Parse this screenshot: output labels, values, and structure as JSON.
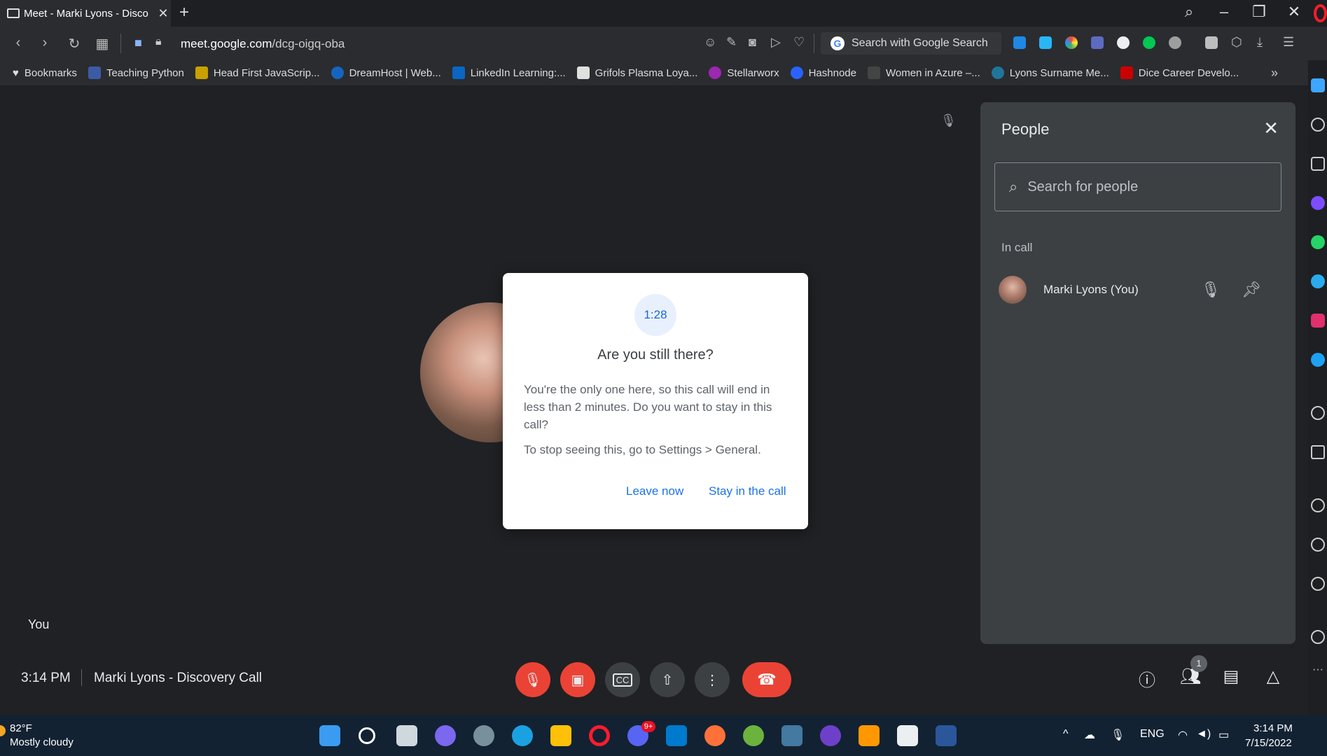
{
  "browser": {
    "tab_title": "Meet - Marki Lyons - Disco",
    "tab_close": "✕",
    "new_tab": "+",
    "url_domain": "meet.google.com",
    "url_path": "/dcg-oigq-oba",
    "search_label": "Search with Google Search",
    "bookmarks": [
      {
        "label": "Bookmarks",
        "color": "#dddddd"
      },
      {
        "label": "Teaching Python",
        "color": "#3b5ba5"
      },
      {
        "label": "Head First JavaScrip...",
        "color": "#c8a000"
      },
      {
        "label": "DreamHost | Web...",
        "color": "#1565c0"
      },
      {
        "label": "LinkedIn Learning:...",
        "color": "#0a66c2"
      },
      {
        "label": "Grifols Plasma Loya...",
        "color": "#e0e0e0"
      },
      {
        "label": "Stellarworx",
        "color": "#9c27b0"
      },
      {
        "label": "Hashnode",
        "color": "#2962ff"
      },
      {
        "label": "Women in Azure –...",
        "color": "#444444"
      },
      {
        "label": "Lyons Surname Me...",
        "color": "#21759b"
      },
      {
        "label": "Dice Career Develo...",
        "color": "#cc0000"
      }
    ],
    "more_bookmarks": "»"
  },
  "meet": {
    "self_tile_label": "You",
    "people_panel": {
      "title": "People",
      "search_placeholder": "Search for people",
      "section_label": "In call",
      "participants": [
        {
          "name": "Marki Lyons (You)"
        }
      ]
    },
    "dialog": {
      "timer": "1:28",
      "title": "Are you still there?",
      "body": "You're the only one here, so this call will end in less than 2 minutes. Do you want to stay in this call?",
      "hint": "To stop seeing this, go to Settings > General.",
      "leave_label": "Leave now",
      "stay_label": "Stay in the call"
    },
    "bottom": {
      "time": "3:14 PM",
      "meeting_name": "Marki Lyons - Discovery Call",
      "people_badge": "1"
    }
  },
  "taskbar": {
    "weather_temp": "82°F",
    "weather_desc": "Mostly cloudy",
    "discord_badge": "9+",
    "language": "ENG",
    "clock_time": "3:14 PM",
    "clock_date": "7/15/2022"
  }
}
